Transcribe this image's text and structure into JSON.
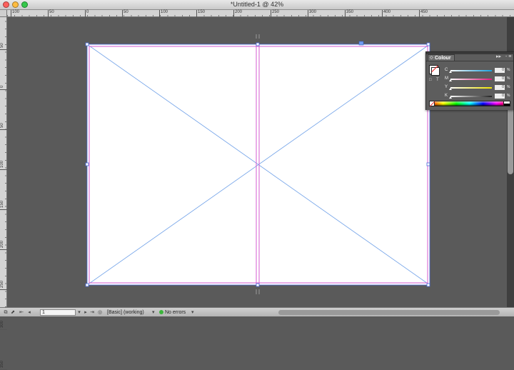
{
  "window": {
    "title": "*Untitled-1 @ 42%"
  },
  "ruler_top": {
    "labels": [
      "100",
      "50",
      "0",
      "50",
      "100",
      "150",
      "200",
      "250",
      "300",
      "350",
      "400",
      "450"
    ]
  },
  "ruler_left": {
    "labels": [
      "50",
      "0",
      "50",
      "100",
      "150",
      "200",
      "250",
      "300",
      "350"
    ]
  },
  "colour_panel": {
    "tab_label": "Colour",
    "tab_arrows": "◇",
    "expand_label": "▸▸",
    "menu_label": "- ≡",
    "rows": [
      {
        "label": "C",
        "value": "0",
        "unit": "%",
        "color": "#19a3e0"
      },
      {
        "label": "M",
        "value": "0",
        "unit": "%",
        "color": "#e2197c"
      },
      {
        "label": "Y",
        "value": "0",
        "unit": "%",
        "color": "#f1e400"
      },
      {
        "label": "K",
        "value": "0",
        "unit": "%",
        "color": "#222222"
      }
    ]
  },
  "statusbar": {
    "page_number": "1",
    "preflight_profile": "[Basic] (working)",
    "errors": "No errors"
  },
  "colors": {
    "margin_guide": "#d45bd0",
    "frame_edge": "#4a6bd8",
    "x_lines": "#6fa0e8"
  }
}
